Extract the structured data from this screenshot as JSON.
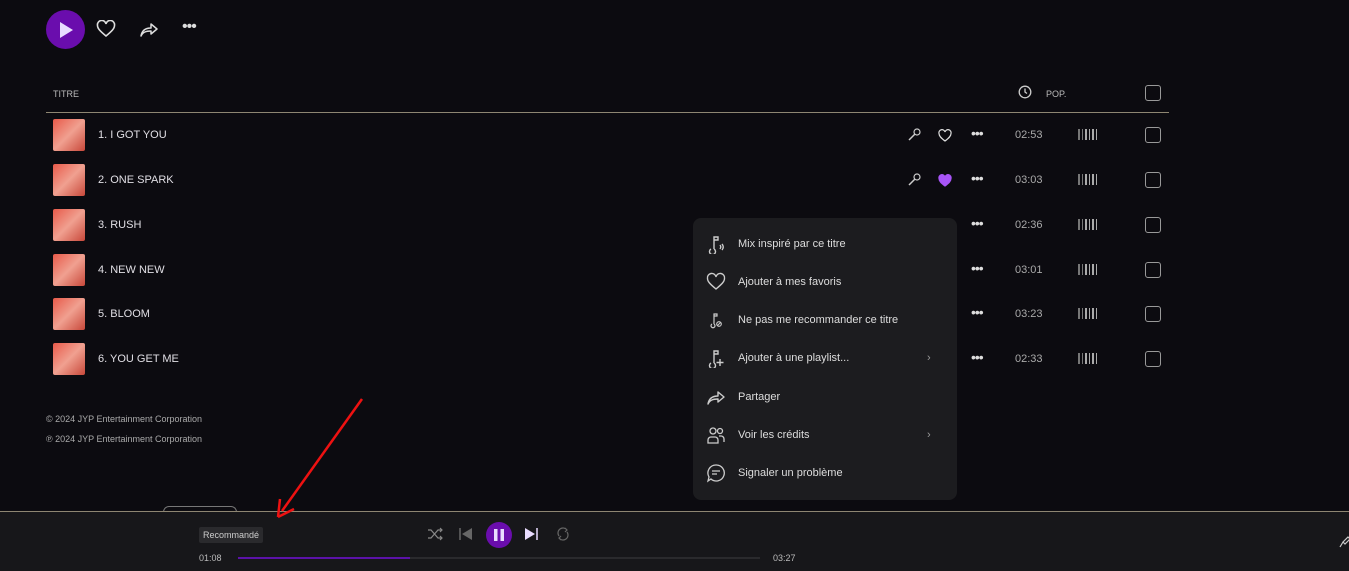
{
  "actions": {
    "play": "play",
    "like": "heart",
    "share": "share",
    "more": "more"
  },
  "table": {
    "title_header": "TITRE",
    "pop_header": "POP."
  },
  "tracks": [
    {
      "title": "1. I GOT YOU",
      "duration": "02:53",
      "liked": false
    },
    {
      "title": "2. ONE SPARK",
      "duration": "03:03",
      "liked": true
    },
    {
      "title": "3. RUSH",
      "duration": "02:36",
      "liked": false
    },
    {
      "title": "4. NEW NEW",
      "duration": "03:01",
      "liked": false
    },
    {
      "title": "5. BLOOM",
      "duration": "03:23",
      "liked": false
    },
    {
      "title": "6. YOU GET ME",
      "duration": "02:33",
      "liked": false
    }
  ],
  "copyright": [
    "© 2024 JYP Entertainment Corporation",
    "℗ 2024 JYP Entertainment Corporation"
  ],
  "menu": [
    "Mix inspiré par ce titre",
    "Ajouter à mes favoris",
    "Ne pas me recommander ce titre",
    "Ajouter à une playlist...",
    "Partager",
    "Voir les crédits",
    "Signaler un problème"
  ],
  "menu_chevron": "›",
  "player": {
    "tooltip": "Recommandé",
    "elapsed": "01:08",
    "total": "03:27",
    "progress": 0.33
  },
  "colors": {
    "accent": "#6a0dad",
    "liked": "#a855f7"
  }
}
